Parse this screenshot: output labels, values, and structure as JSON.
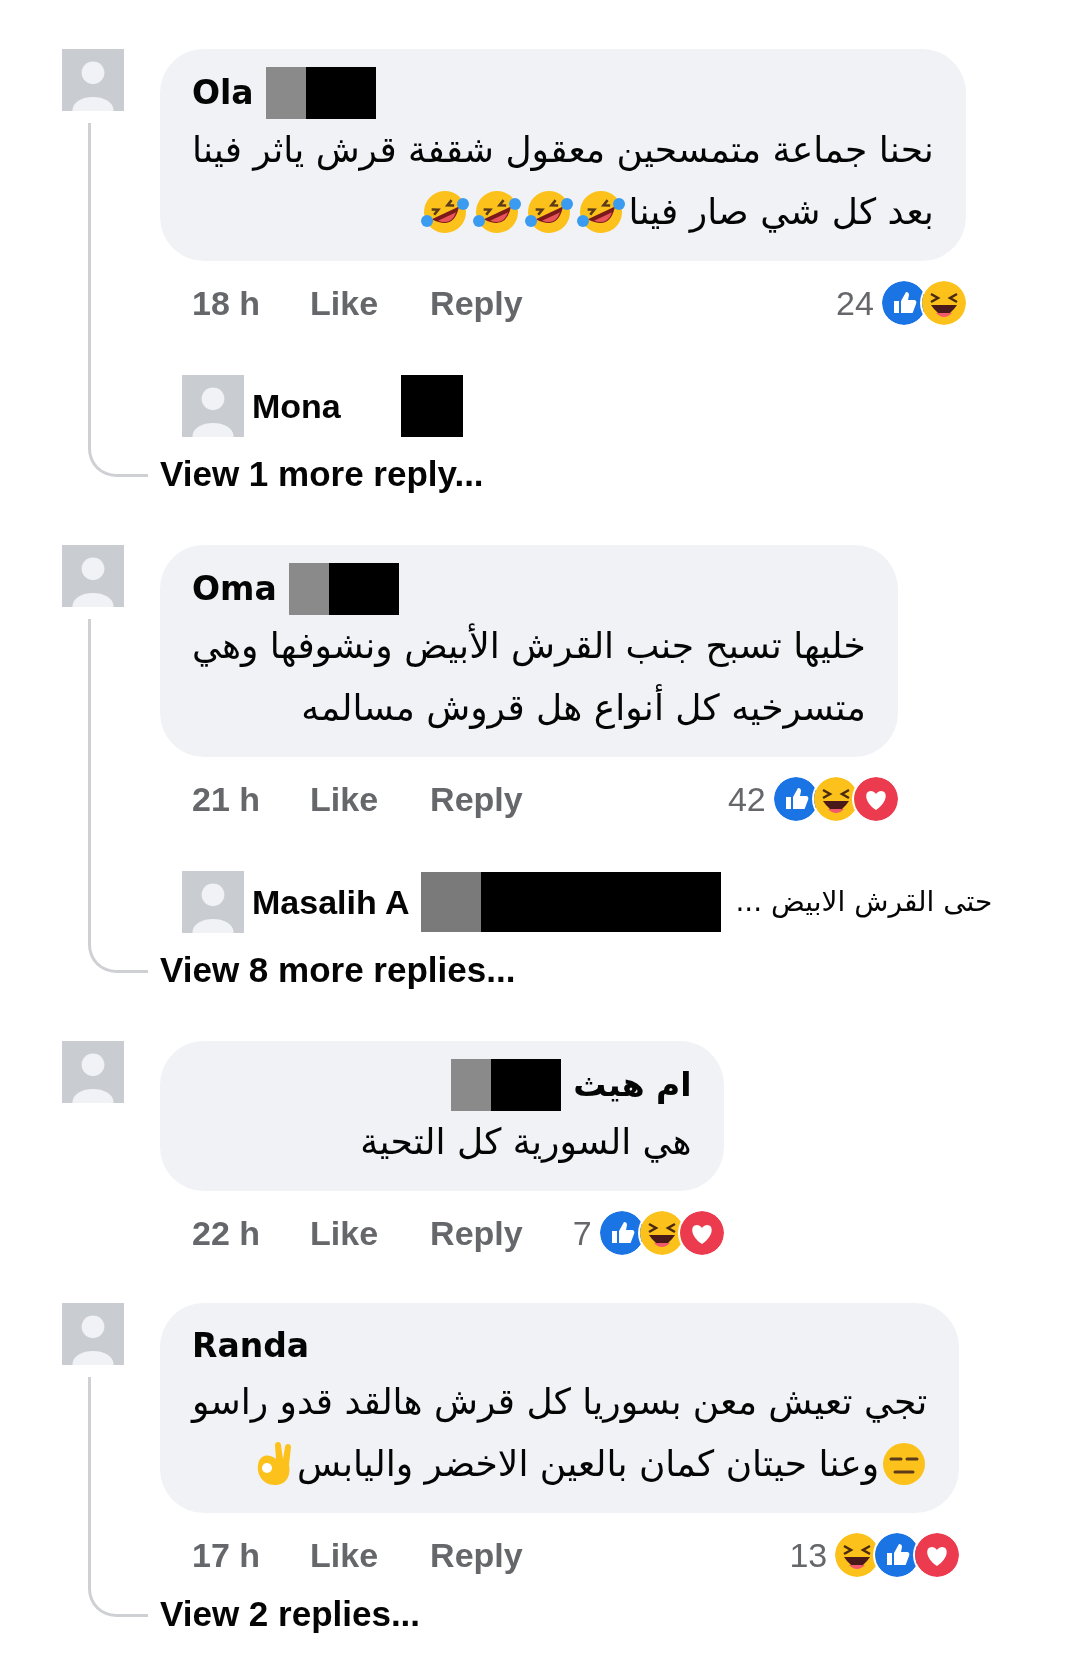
{
  "comments": [
    {
      "name": "Ola",
      "redacted": true,
      "lines": [
        [
          {
            "kind": "text",
            "text": "نحنا جماعة متمسحين معقول شقفة قرش ياثر فينا"
          }
        ],
        [
          {
            "kind": "text",
            "text": "بعد كل شي صار فينا"
          },
          {
            "kind": "rofl"
          },
          {
            "kind": "rofl"
          },
          {
            "kind": "rofl"
          },
          {
            "kind": "rofl"
          }
        ]
      ],
      "time": "18 h",
      "like": "Like",
      "reply": "Reply",
      "count": "24",
      "reactions": [
        {
          "kind": "like"
        },
        {
          "kind": "haha"
        }
      ],
      "reply_preview": {
        "name": "Mona"
      },
      "view_more": "View 1 more reply..."
    },
    {
      "name": "Oma",
      "redacted": true,
      "lines": [
        [
          {
            "kind": "text",
            "text": "خليها تسبح جنب القرش الأبيض ونشوفها وهي"
          }
        ],
        [
          {
            "kind": "text",
            "text": "متسرخيه كل أنواع هل قروش مسالمه"
          }
        ]
      ],
      "time": "21 h",
      "like": "Like",
      "reply": "Reply",
      "count": "42",
      "reactions": [
        {
          "kind": "like"
        },
        {
          "kind": "haha"
        },
        {
          "kind": "love"
        }
      ],
      "reply_preview": {
        "name": "Masalih A",
        "snippet": "حتى القرش الابيض ..."
      },
      "view_more": "View 8 more replies..."
    },
    {
      "name": "ام هيث",
      "redacted": true,
      "lines": [
        [
          {
            "kind": "text",
            "text": "هي السورية كل التحية"
          }
        ]
      ],
      "time": "22 h",
      "like": "Like",
      "reply": "Reply",
      "count": "7",
      "reactions": [
        {
          "kind": "like"
        },
        {
          "kind": "haha"
        },
        {
          "kind": "love"
        }
      ]
    },
    {
      "name": "Randa",
      "redacted": false,
      "lines": [
        [
          {
            "kind": "text",
            "text": "تجي تعيش معن بسوريا كل قرش هالقد قدو راسو"
          }
        ],
        [
          {
            "kind": "expressionless"
          },
          {
            "kind": "text",
            "text": "وعنا حيتان كمان بالعين الاخضر واليابس"
          },
          {
            "kind": "ok"
          }
        ]
      ],
      "time": "17 h",
      "like": "Like",
      "reply": "Reply",
      "count": "13",
      "reactions": [
        {
          "kind": "haha"
        },
        {
          "kind": "like"
        },
        {
          "kind": "love"
        }
      ],
      "view_more": "View 2 replies..."
    }
  ]
}
